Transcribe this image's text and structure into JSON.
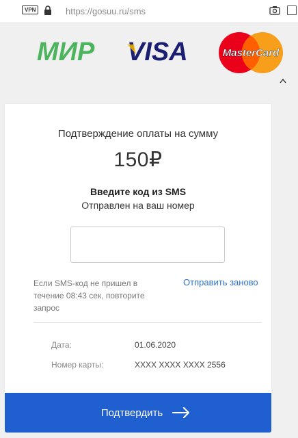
{
  "browser": {
    "vpn_badge": "VPN",
    "url": "https://gosuu.ru/sms",
    "icons": [
      "lock-icon",
      "camera-icon",
      "checkbox-icon"
    ]
  },
  "logos": {
    "mir": "МИР",
    "visa": "VISA",
    "mastercard": "MasterCard"
  },
  "payment": {
    "title": "Подтверждение оплаты на сумму",
    "amount": "150₽",
    "sms_heading": "Введите код из SMS",
    "sms_sub": "Отправлен на ваш номер",
    "code_value": "",
    "resend_note": "Если SMS-код не пришел в течение 08:43 сек, повторите запрос",
    "resend_link": "Отправить заново",
    "date_label": "Дата:",
    "date_value": "01.06.2020",
    "card_label": "Номер карты:",
    "card_value": "XXXX XXXX XXXX 2556",
    "confirm_label": "Подтвердить"
  },
  "colors": {
    "mir_green": "#4db45e",
    "visa_blue": "#1a1f71",
    "visa_gold": "#f7b600",
    "mc_red": "#eb001b",
    "mc_orange": "#f79e1b",
    "button_blue": "#1f5fcf",
    "link_blue": "#2f6fc8"
  }
}
